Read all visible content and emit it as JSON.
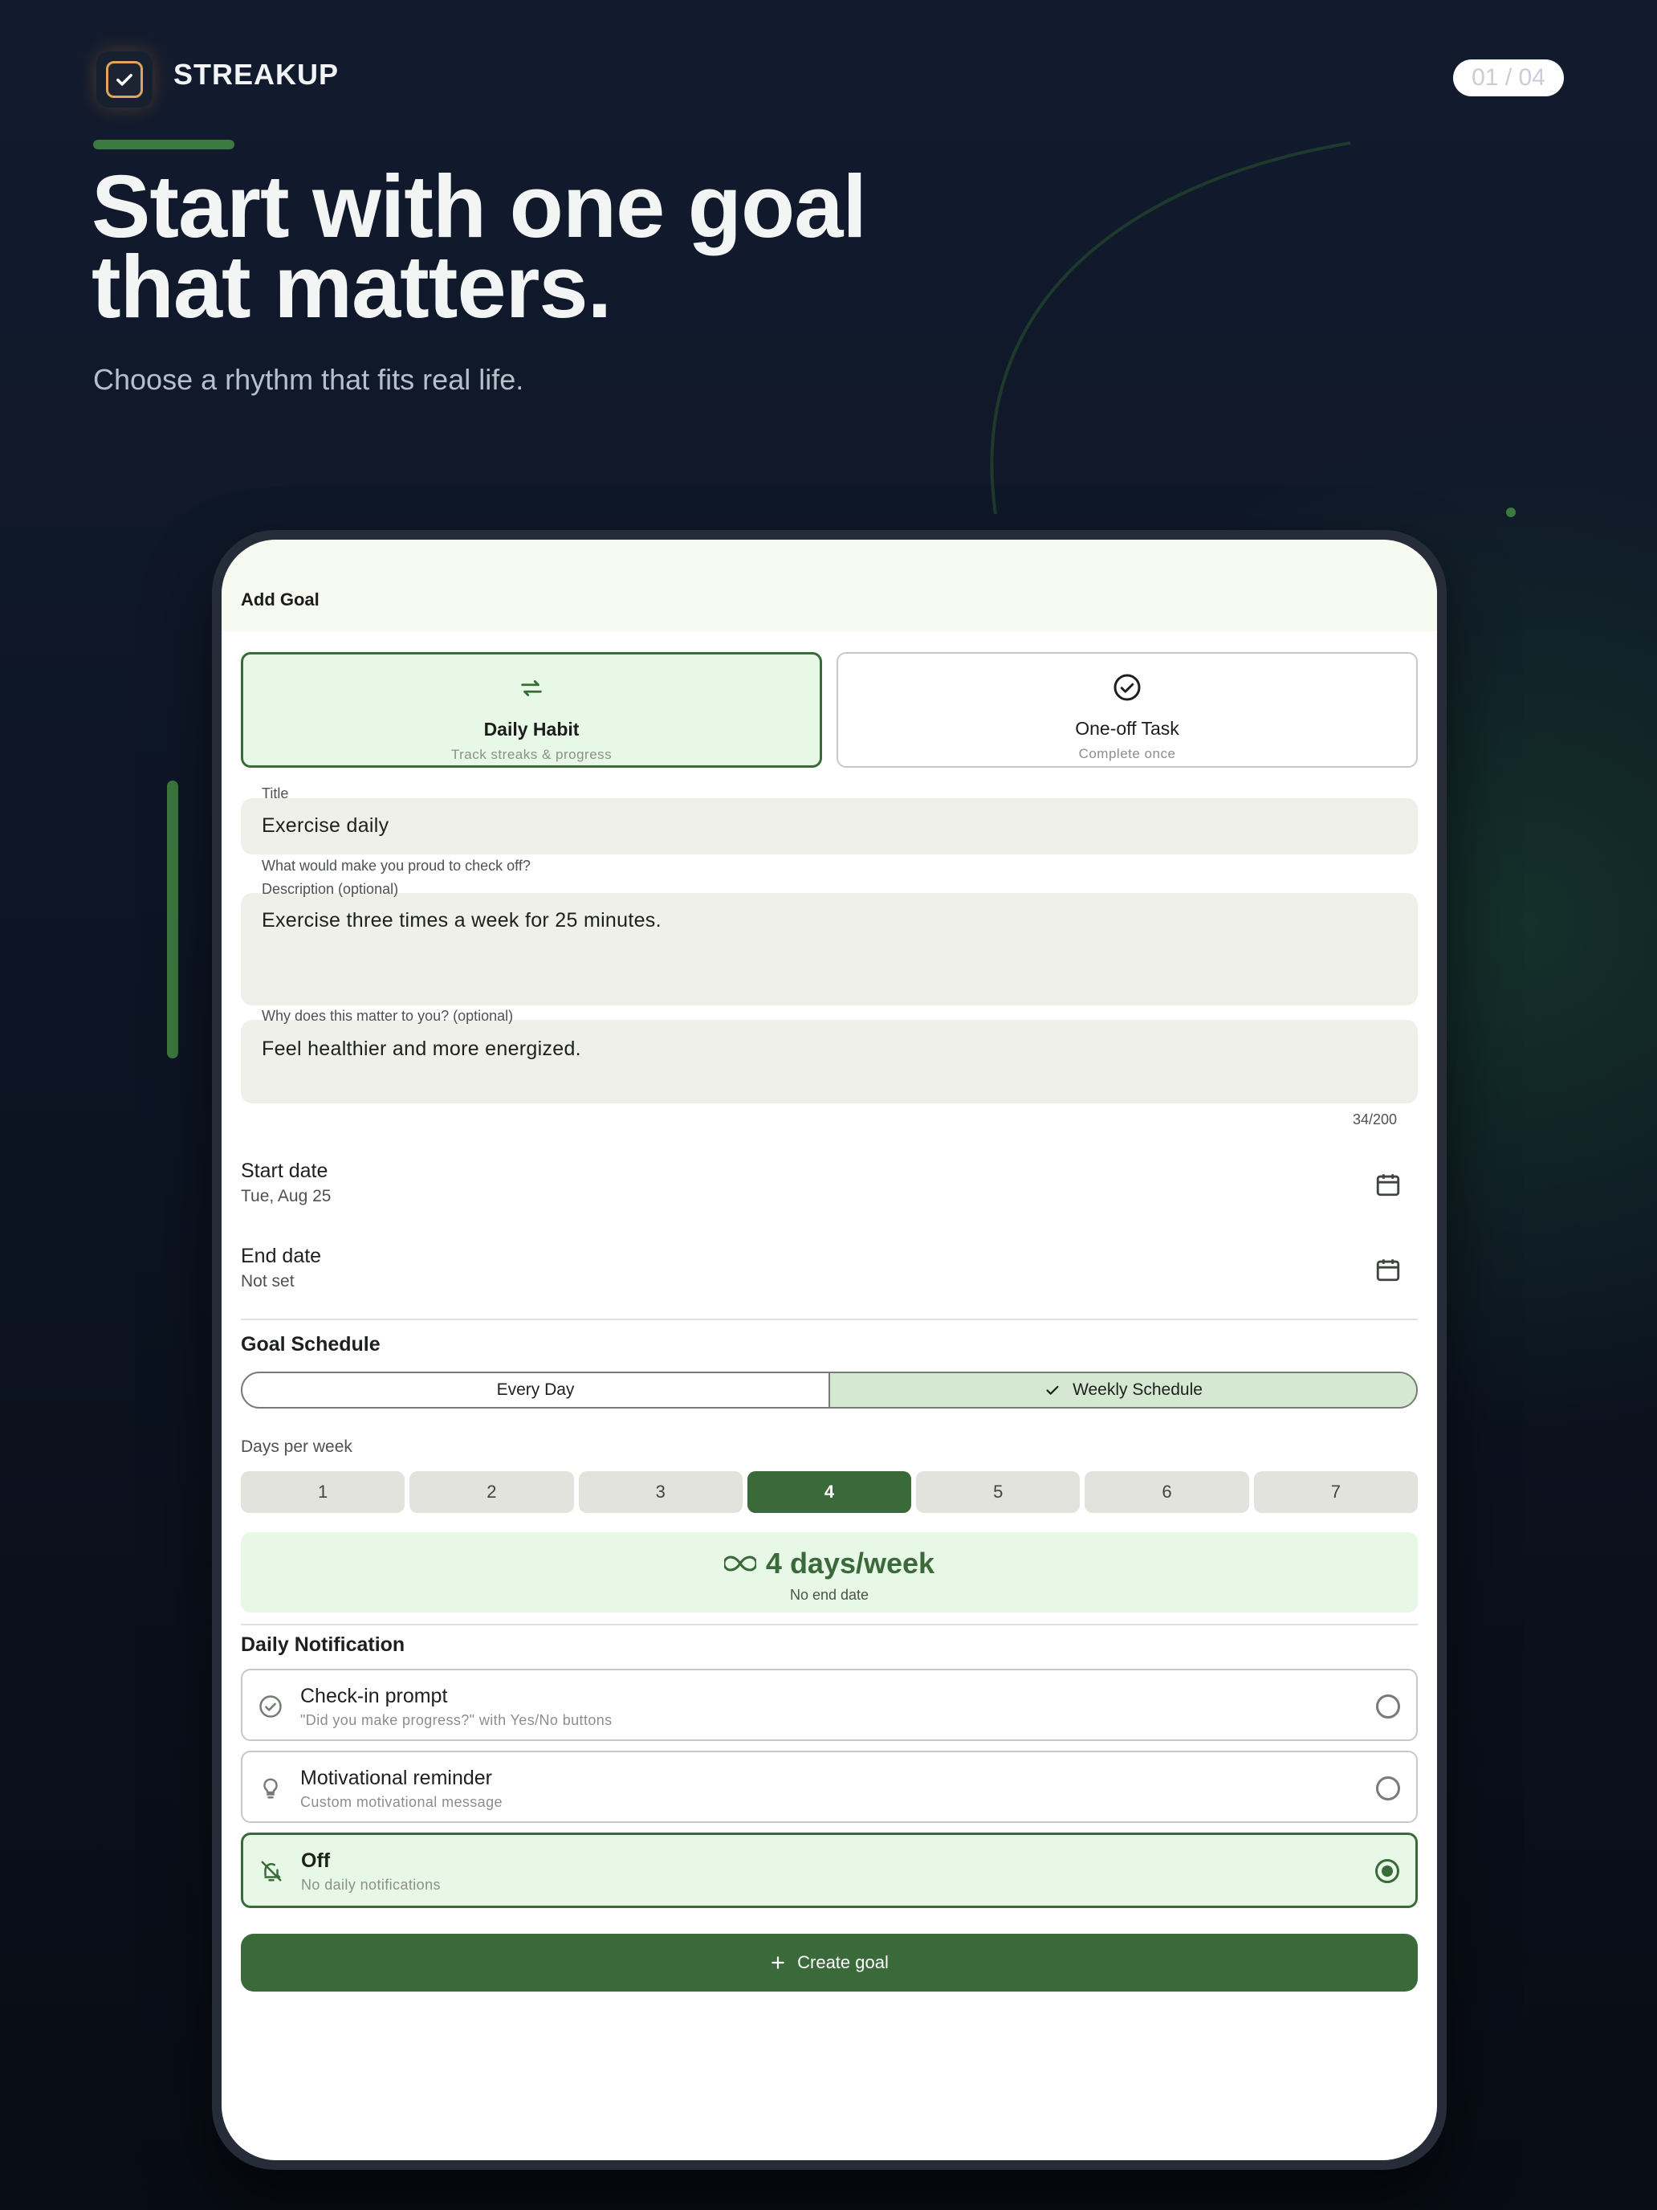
{
  "brand": {
    "name": "STREAKUP",
    "logo_icon": "checkbox-icon"
  },
  "pager": "01 / 04",
  "hero": {
    "headline_line1": "Start with one goal",
    "headline_line2": "that matters.",
    "subhead": "Choose a rhythm that fits real life."
  },
  "screen": {
    "title": "Add Goal",
    "goal_types": [
      {
        "label": "Daily Habit",
        "sub": "Track streaks & progress",
        "icon": "repeat-icon",
        "selected": true
      },
      {
        "label": "One-off Task",
        "sub": "Complete once",
        "icon": "check-circle-icon",
        "selected": false
      }
    ],
    "title_field": {
      "label": "Title",
      "value": "Exercise daily",
      "helper": "What would make you proud to check off?"
    },
    "description_field": {
      "label": "Description (optional)",
      "value": "Exercise three times a week for 25 minutes."
    },
    "why_field": {
      "label": "Why does this matter to you? (optional)",
      "value": "Feel healthier and more energized.",
      "counter": "34/200"
    },
    "start_date": {
      "label": "Start date",
      "value": "Tue, Aug 25"
    },
    "end_date": {
      "label": "End date",
      "value": "Not set"
    },
    "schedule": {
      "title": "Goal Schedule",
      "options": [
        "Every Day",
        "Weekly Schedule"
      ],
      "selected": "Weekly Schedule",
      "days_label": "Days per week",
      "days": [
        "1",
        "2",
        "3",
        "4",
        "5",
        "6",
        "7"
      ],
      "selected_day": "4",
      "summary_value": "4 days/week",
      "summary_sub": "No end date"
    },
    "notification": {
      "title": "Daily Notification",
      "options": [
        {
          "title": "Check-in prompt",
          "sub": "\"Did you make progress?\" with Yes/No buttons",
          "icon": "check-circle-icon",
          "selected": false
        },
        {
          "title": "Motivational reminder",
          "sub": "Custom motivational message",
          "icon": "lightbulb-icon",
          "selected": false
        },
        {
          "title": "Off",
          "sub": "No daily notifications",
          "icon": "bell-off-icon",
          "selected": true
        }
      ]
    },
    "cta": "Create goal"
  },
  "colors": {
    "accent": "#3b6a3a",
    "accent_light": "#e8f8e6",
    "bg_dark": "#0d1524"
  }
}
